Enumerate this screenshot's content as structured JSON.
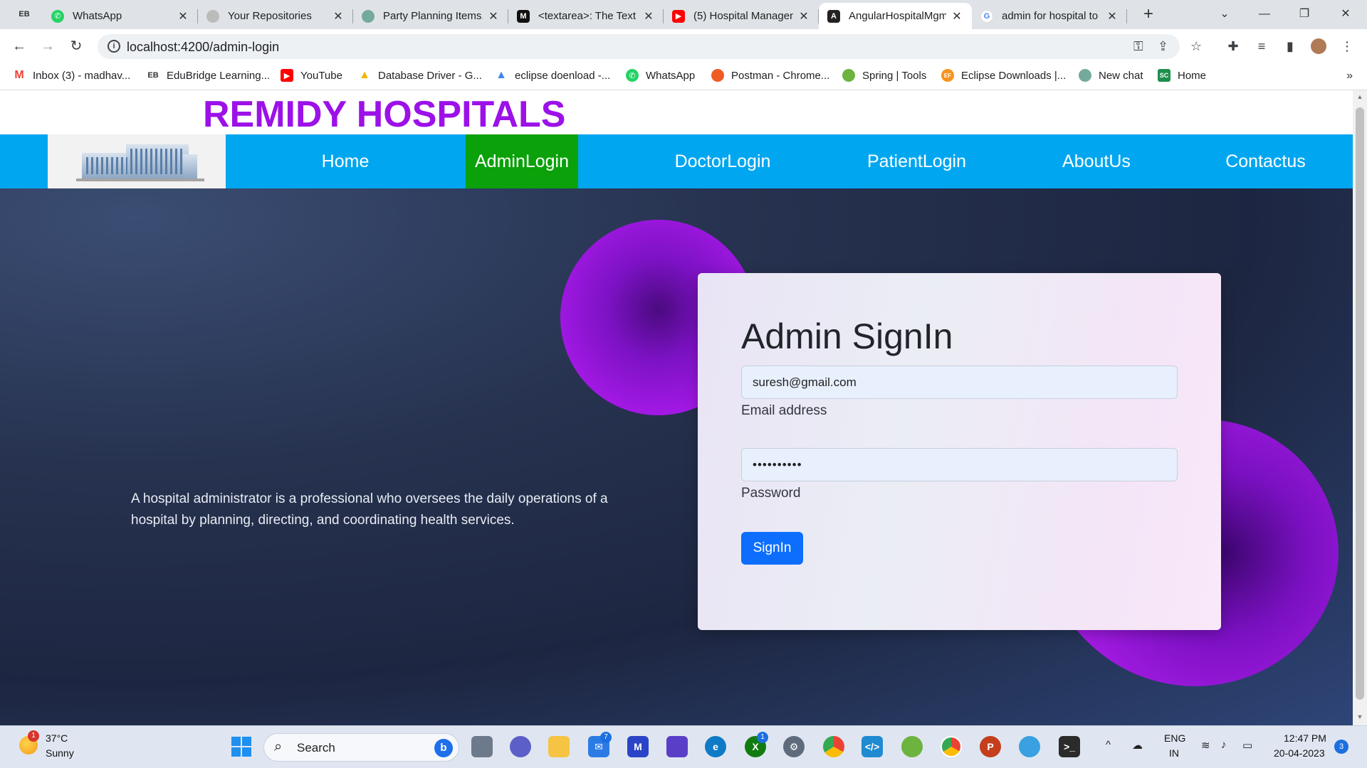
{
  "browser": {
    "profile_label": "EB",
    "tabs": [
      {
        "title": "WhatsApp",
        "close": "✕"
      },
      {
        "title": "Your Repositories",
        "close": "✕"
      },
      {
        "title": "Party Planning Items.",
        "close": "✕"
      },
      {
        "title": "<textarea>: The Text",
        "close": "✕"
      },
      {
        "title": "(5) Hospital Managem",
        "close": "✕"
      },
      {
        "title": "AngularHospitalMgm",
        "close": "✕"
      },
      {
        "title": "admin for hospital to",
        "close": "✕"
      }
    ],
    "new_tab": "+",
    "url": "localhost:4200/admin-login",
    "bookmarks": [
      {
        "label": "Inbox (3) - madhav..."
      },
      {
        "label": "EduBridge Learning..."
      },
      {
        "label": "YouTube"
      },
      {
        "label": "Database Driver - G..."
      },
      {
        "label": "eclipse doenload -..."
      },
      {
        "label": "WhatsApp"
      },
      {
        "label": "Postman - Chrome..."
      },
      {
        "label": "Spring | Tools"
      },
      {
        "label": "Eclipse Downloads |..."
      },
      {
        "label": "New chat"
      },
      {
        "label": "Home"
      }
    ],
    "bookmarks_more": "»"
  },
  "site": {
    "title": "REMIDY HOSPITALS",
    "nav": [
      {
        "label": "Home"
      },
      {
        "label": "AdminLogin"
      },
      {
        "label": "DoctorLogin"
      },
      {
        "label": "PatientLogin"
      },
      {
        "label": "AboutUs"
      },
      {
        "label": "Contactus"
      }
    ],
    "active_nav": "AdminLogin",
    "intro": "A hospital administrator is a professional who oversees the daily operations of a hospital by planning, directing, and coordinating health services.",
    "signin": {
      "title": "Admin SignIn",
      "email_value": "suresh@gmail.com",
      "email_label": "Email address",
      "password_value": "••••••••••",
      "password_label": "Password",
      "button": "SignIn"
    },
    "colors": {
      "title": "#9c11e8",
      "nav": "#00a6f0",
      "active_nav": "#0aa10a",
      "button": "#0d6efd"
    }
  },
  "taskbar": {
    "weather_badge": "1",
    "temperature": "37°C",
    "condition": "Sunny",
    "search": "Search",
    "mail_badge": "7",
    "xbox_badge": "1",
    "lang_top": "ENG",
    "lang_bottom": "IN",
    "time": "12:47 PM",
    "date": "20-04-2023",
    "notifications": "3"
  }
}
